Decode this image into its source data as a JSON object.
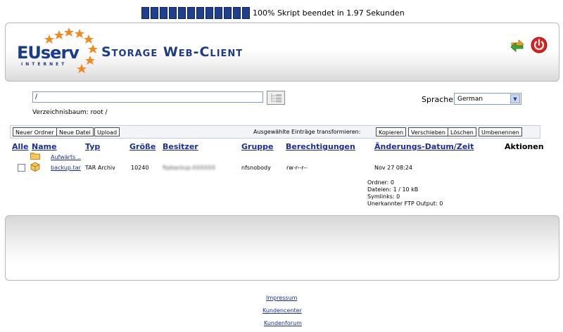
{
  "status": {
    "progress_percent": 100,
    "progress_text": "100% Skript beendet in 1.97 Sekunden"
  },
  "header": {
    "logo_text": "EUserv",
    "logo_subtext": "INTERNET",
    "title": "Storage Web-Client",
    "icons": [
      "refresh-icon",
      "power-icon"
    ],
    "colors": {
      "brand_blue": "#1c3c86",
      "star_orange": "#f08a1c",
      "power_red": "#e02020"
    }
  },
  "controls": {
    "path_value": "/",
    "tree_label": "Verzeichnisbaum: root /",
    "language_label": "Sprache:",
    "language_selected": "German"
  },
  "toolbar": {
    "new_folder": "Neuer Ordner",
    "new_file": "Neue Datei",
    "upload": "Upload",
    "transform_label": "Ausgewählte Einträge transformieren:",
    "copy": "Kopieren",
    "move": "Verschieben",
    "delete": "Löschen",
    "rename": "Umbenennen"
  },
  "table": {
    "headers": {
      "all": "Alle",
      "name": "Name",
      "type": "Typ",
      "size": "Größe",
      "owner": "Besitzer",
      "group": "Gruppe",
      "permissions": "Berechtigungen",
      "modified": "Änderungs-Datum/Zeit",
      "actions": "Aktionen"
    },
    "up_link": "Aufwärts ..",
    "rows": [
      {
        "name": "backup.tar",
        "type": "TAR Archiv",
        "size": "10240",
        "owner": "ftpbackup-XXXXXX",
        "group": "nfsnobody",
        "permissions": "rw-r--r--",
        "modified": "Nov 27 08:24"
      }
    ]
  },
  "stats": {
    "folders": "Ordner: 0",
    "files": "Dateien: 1 / 10 kB",
    "symlinks": "Symlinks: 0",
    "unknown": "Unerkannter FTP Output: 0"
  },
  "footer": {
    "links": [
      "Impressum",
      "Kundencenter",
      "Kundenforum"
    ]
  }
}
